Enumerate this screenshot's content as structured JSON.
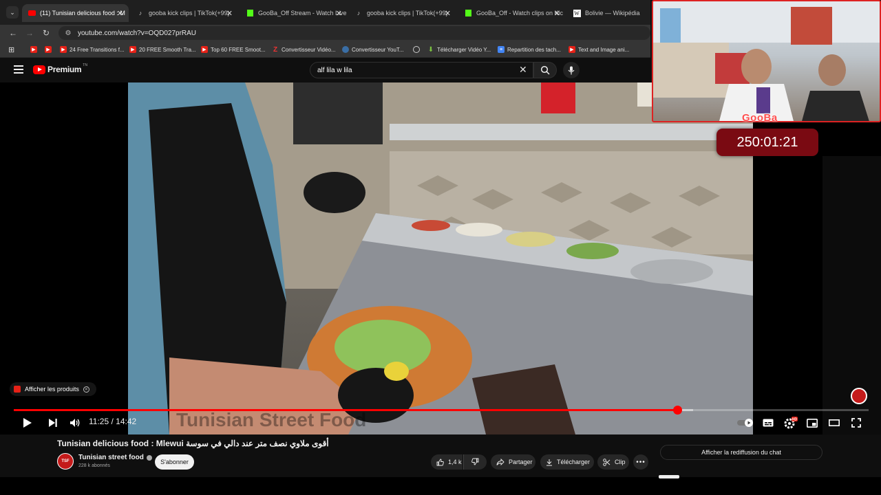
{
  "browser": {
    "tabs": [
      {
        "title": "(11) Tunisian delicious food : M",
        "favicon": "youtube-icon",
        "active": true
      },
      {
        "title": "gooba kick clips | TikTok(+99)",
        "favicon": "tiktok-icon",
        "active": false
      },
      {
        "title": "GooBa_Off Stream - Watch Live",
        "favicon": "kick-icon",
        "active": false
      },
      {
        "title": "gooba kick clips | TikTok(+99)",
        "favicon": "tiktok-icon",
        "active": false
      },
      {
        "title": "GooBa_Off - Watch clips on Kic",
        "favicon": "kick-icon",
        "active": false
      },
      {
        "title": "Bolivie — Wikipédia",
        "favicon": "wikipedia-icon",
        "active": false
      }
    ],
    "url": "youtube.com/watch?v=OQD027prRAU",
    "bookmarks": [
      {
        "label": "",
        "icon": "youtube-icon"
      },
      {
        "label": "",
        "icon": "youtube-icon"
      },
      {
        "label": "24 Free Transitions f...",
        "icon": "youtube-icon"
      },
      {
        "label": "20 FREE Smooth Tra...",
        "icon": "youtube-icon"
      },
      {
        "label": "Top 60 FREE Smoot...",
        "icon": "youtube-icon"
      },
      {
        "label": "Convertisseur Vidéo...",
        "icon": "z-icon"
      },
      {
        "label": "Convertisseur YouT...",
        "icon": "converter-icon"
      },
      {
        "label": "",
        "icon": "globe-icon"
      },
      {
        "label": "Télécharger Vidéo Y...",
        "icon": "download-icon"
      },
      {
        "label": "Repartition des tach...",
        "icon": "docs-icon"
      },
      {
        "label": "Text and Image ani...",
        "icon": "youtube-icon"
      }
    ]
  },
  "youtube": {
    "logo_text": "Premium",
    "logo_sup": "TN",
    "search_query": "alf lila w lila"
  },
  "stream_overlay": {
    "brand": "GooBa",
    "timer": "250:01:21"
  },
  "player": {
    "products_chip": "Afficher les produits",
    "current_time": "11:25",
    "separator": "/",
    "duration": "14:42",
    "progress_fraction": 0.776,
    "loaded_fraction": 0.795,
    "watermark": "Tunisian Street Food"
  },
  "video": {
    "title": "Tunisian delicious food : Mlewui أقوى ملاوي نصف متر عند دالي في سوسة",
    "channel_name": "Tunisian street food",
    "subscribers": "228 k abonnés",
    "subscribe_label": "S'abonner",
    "likes": "1,4 k",
    "share_label": "Partager",
    "download_label": "Télécharger",
    "clip_label": "Clip",
    "chat_replay_label": "Afficher la rediffusion du chat"
  },
  "colors": {
    "youtube_red": "#ff0000",
    "background": "#0f0f0f",
    "timer_bg": "#7a0a12"
  }
}
